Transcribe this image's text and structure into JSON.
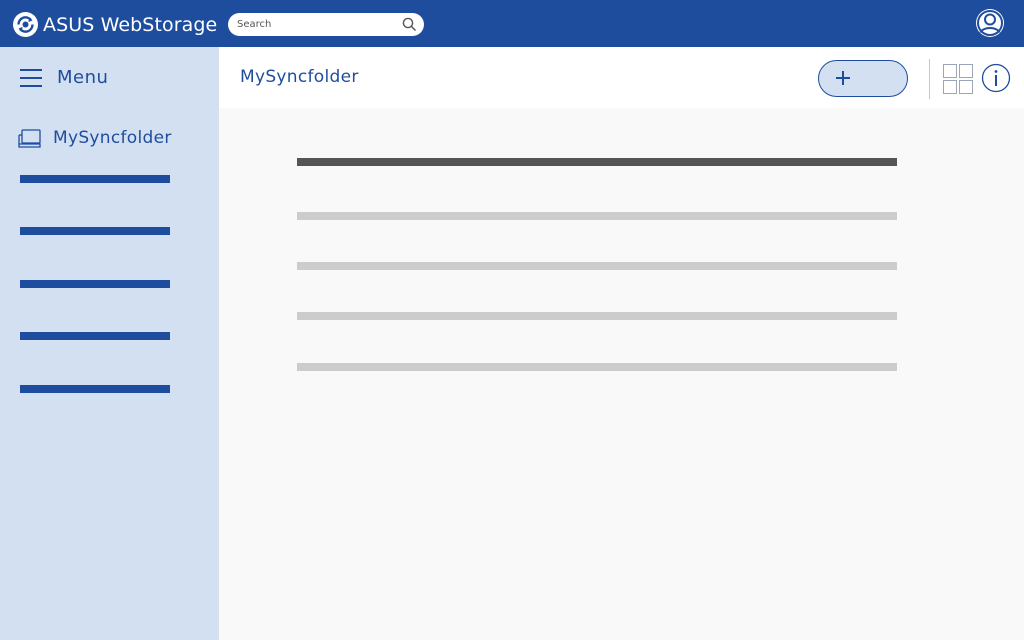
{
  "app": {
    "title": "ASUS WebStorage",
    "brand_color": "#1f4d9e",
    "sidebar_color": "#d3e0f2"
  },
  "search": {
    "placeholder": "Search",
    "value": "",
    "icon": "search-icon"
  },
  "user": {
    "icon": "user-avatar-icon"
  },
  "sidebar": {
    "menu_label": "Menu",
    "menu_icon": "hamburger-icon",
    "folder_label": "MySyncfolder",
    "folder_icon": "laptop-icon",
    "placeholder_items": [
      {
        "state": "placeholder"
      },
      {
        "state": "placeholder"
      },
      {
        "state": "placeholder"
      },
      {
        "state": "placeholder"
      },
      {
        "state": "placeholder"
      }
    ]
  },
  "header": {
    "title": "MySyncfolder",
    "add_button_icon": "plus-icon",
    "view_toggle_icon": "grid-view-icon",
    "info_icon": "info-icon"
  },
  "file_list": {
    "header_state": "placeholder",
    "rows": [
      {
        "state": "placeholder"
      },
      {
        "state": "placeholder"
      },
      {
        "state": "placeholder"
      },
      {
        "state": "placeholder"
      }
    ]
  }
}
